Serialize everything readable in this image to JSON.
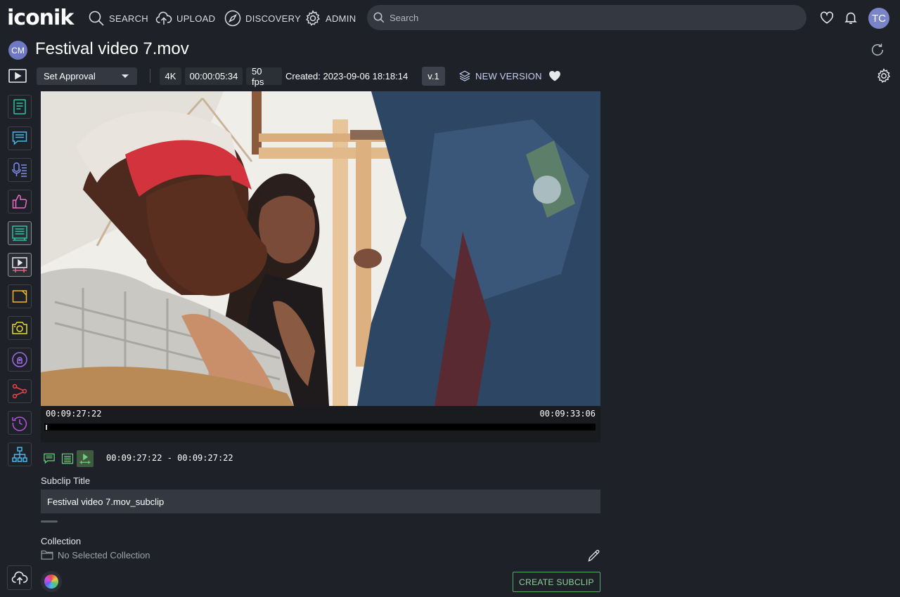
{
  "app": {
    "logo": "iconik"
  },
  "nav": {
    "search": "SEARCH",
    "upload": "UPLOAD",
    "discovery": "DISCOVERY",
    "admin": "ADMIN"
  },
  "search": {
    "placeholder": "Search"
  },
  "user": {
    "initials": "TC"
  },
  "asset": {
    "owner_initials": "CM",
    "title": "Festival video 7.mov",
    "approval": "Set Approval",
    "resolution": "4K",
    "duration": "00:00:05:34",
    "fps": "50 fps",
    "created": "Created: 2023-09-06 18:18:14",
    "version": "v.1",
    "new_version_label": "NEW VERSION"
  },
  "player": {
    "timecode_start": "00:09:27:22",
    "timecode_end": "00:09:33:06",
    "playhead_fraction": 0
  },
  "subclip": {
    "range": "00:09:27:22 - 00:09:27:22",
    "title_label": "Subclip Title",
    "title_value": "Festival video 7.mov_subclip",
    "collection_label": "Collection",
    "collection_value": "No Selected Collection",
    "create_label": "CREATE SUBCLIP"
  },
  "sidebar_icons": [
    {
      "name": "metadata-icon",
      "color": "#2bc4a4"
    },
    {
      "name": "comments-icon",
      "color": "#4ab6e8"
    },
    {
      "name": "transcription-icon",
      "color": "#7f8cf0"
    },
    {
      "name": "approval-icon",
      "color": "#e86fc6"
    },
    {
      "name": "segments-icon",
      "color": "#2bc4a4"
    },
    {
      "name": "subclip-icon",
      "color": "#e85f8a"
    },
    {
      "name": "annotation-icon",
      "color": "#f0b82e"
    },
    {
      "name": "snapshot-icon",
      "color": "#e8dc2e"
    },
    {
      "name": "permissions-icon",
      "color": "#a06ce8"
    },
    {
      "name": "share-icon",
      "color": "#e8484b"
    },
    {
      "name": "history-icon",
      "color": "#b055e0"
    },
    {
      "name": "relations-icon",
      "color": "#4ab6e8"
    }
  ],
  "colors": {
    "accent_green": "#5aa86a",
    "background": "#1e2127"
  }
}
